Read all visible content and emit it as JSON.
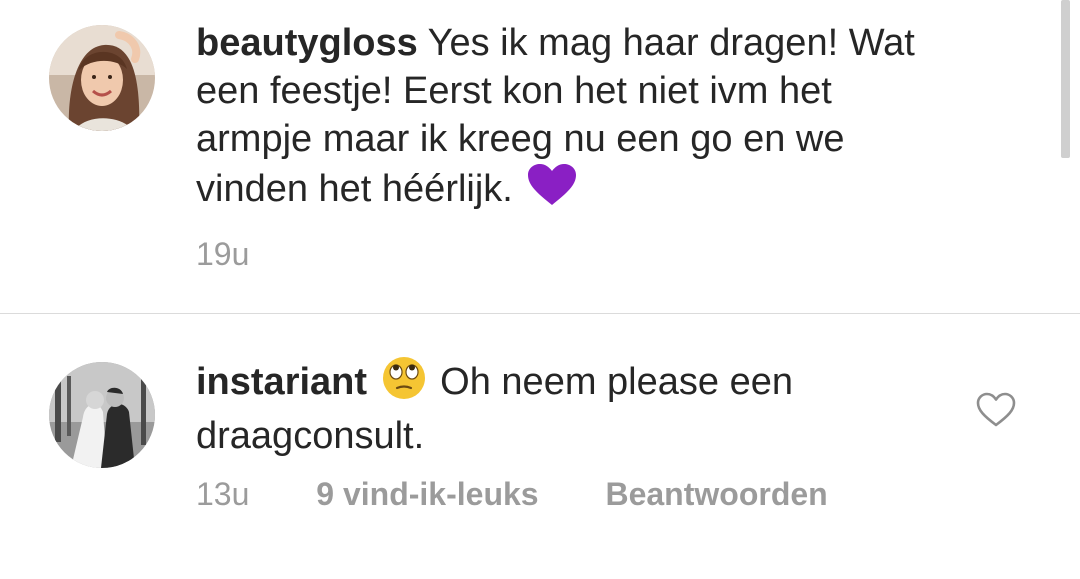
{
  "comments": [
    {
      "username": "beautygloss",
      "text_lines": [
        "Yes ik mag haar dragen! Wat",
        "een feestje! Eerst kon het niet ivm het",
        "armpje maar ik kreeg nu een go en we",
        "vinden het héérlijk."
      ],
      "text": "Yes ik mag haar dragen! Wat een feestje! Eerst kon het niet ivm het armpje maar ik kreeg nu een go en we vinden het héérlijk.",
      "emoji": "purple-heart-icon",
      "time": "19u"
    },
    {
      "username": "instariant",
      "emoji": "eye-roll-face-icon",
      "text": "Oh neem please een draagconsult.",
      "time": "13u",
      "likes": "9 vind-ik-leuks",
      "reply_label": "Beantwoorden",
      "like_icon": "heart-outline-icon"
    }
  ],
  "colors": {
    "text": "#262626",
    "meta": "#9b9b9b",
    "divider": "#dbdbdb",
    "purple_heart": "#8a1fc4",
    "emoji_yellow": "#f5c533"
  }
}
